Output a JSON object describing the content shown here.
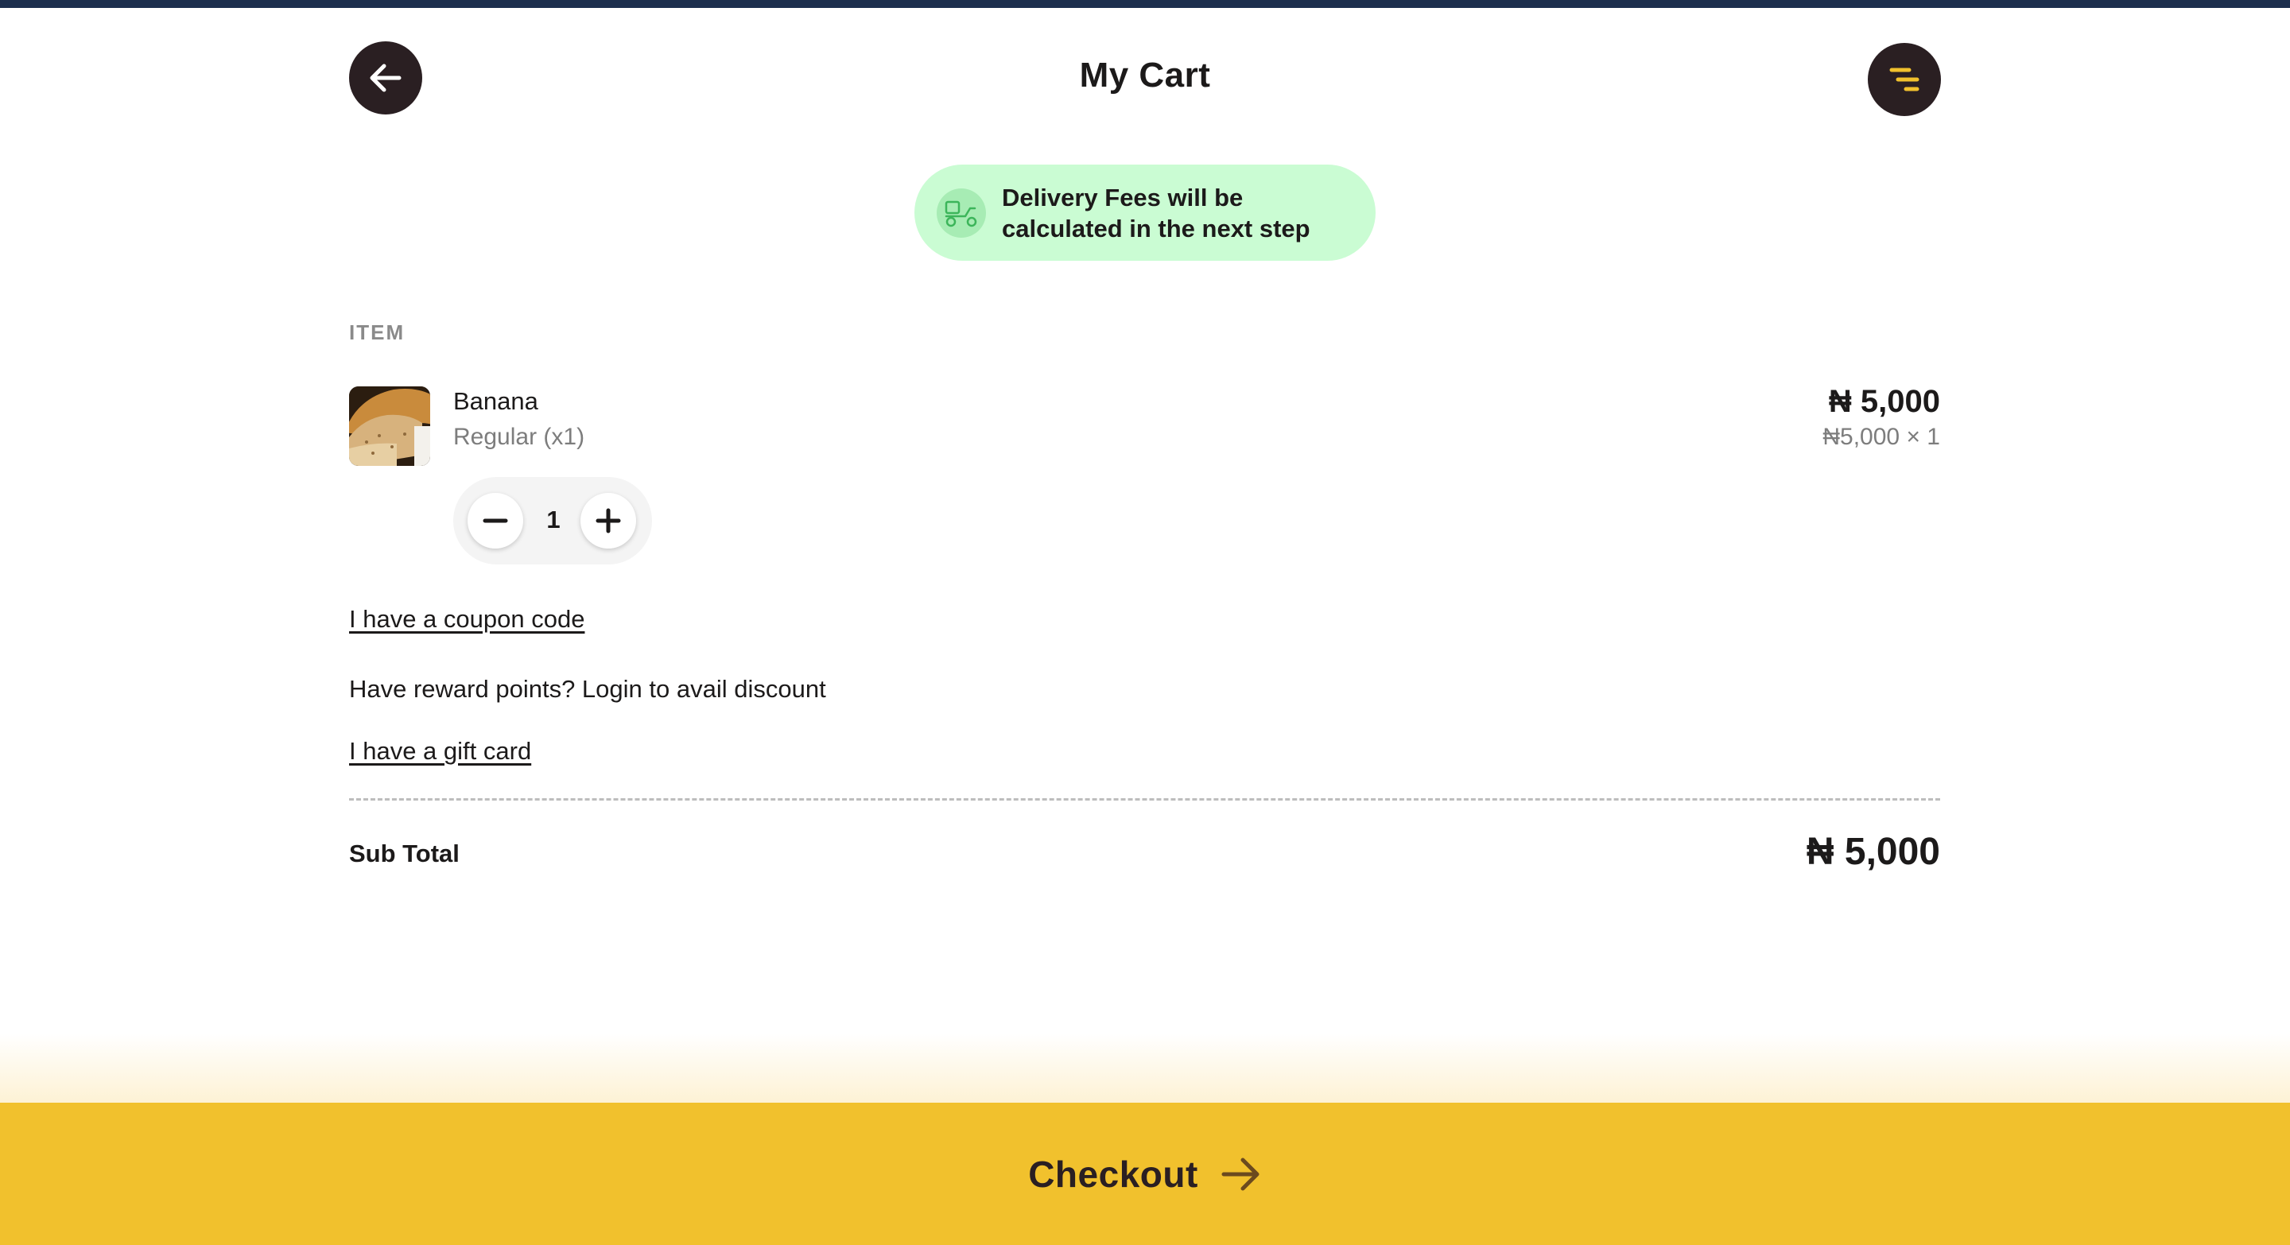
{
  "header": {
    "title": "My Cart",
    "back_icon": "arrow-left-icon",
    "menu_icon": "menu-lines-icon"
  },
  "delivery_notice": {
    "line1": "Delivery Fees will be",
    "line2": "calculated in the next step",
    "icon": "delivery-scooter-icon"
  },
  "items_section": {
    "label": "ITEM",
    "items": [
      {
        "name": "Banana",
        "variant": "Regular (x1)",
        "price": "₦ 5,000",
        "unit_price": "₦5,000 × 1",
        "quantity": "1"
      }
    ]
  },
  "links": {
    "coupon": "I have a coupon code",
    "reward": "Have reward points? Login to avail discount",
    "gift_card": "I have a gift card"
  },
  "summary": {
    "subtotal_label": "Sub Total",
    "subtotal_value": "₦ 5,000"
  },
  "checkout": {
    "label": "Checkout",
    "icon": "arrow-right-icon"
  },
  "colors": {
    "accent": "#f1c12d",
    "dark": "#2a1f22",
    "notice_bg": "#cafcd3",
    "notice_icon": "#3cb55a",
    "top_bar": "#1d2f4e"
  }
}
